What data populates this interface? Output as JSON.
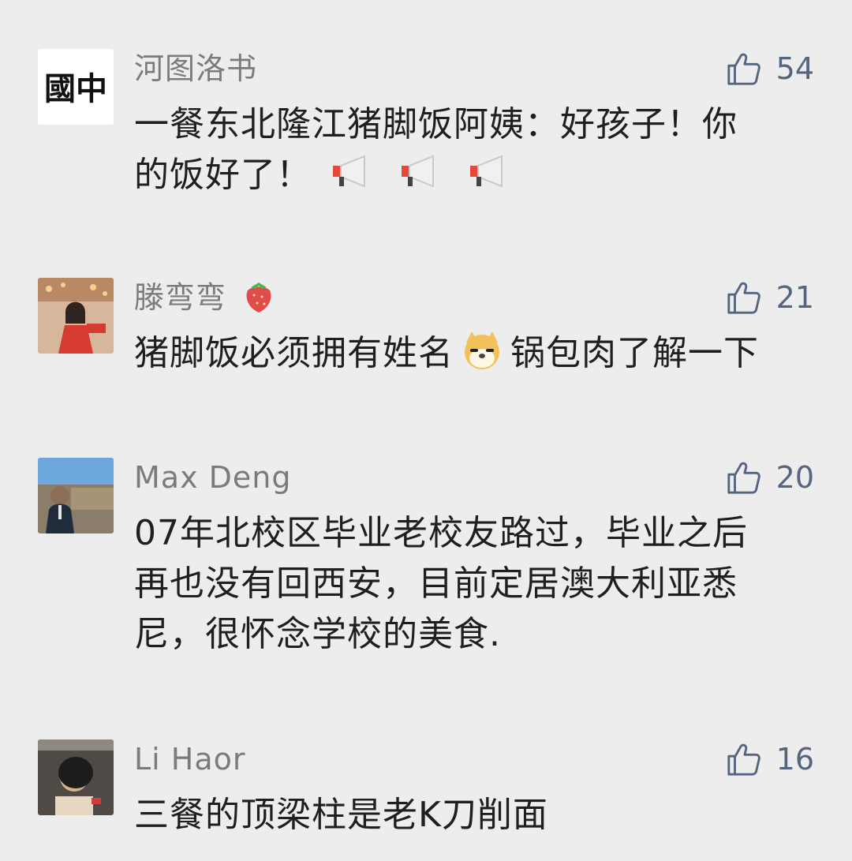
{
  "comments": [
    {
      "name": "河图洛书",
      "avatar_text": "國中",
      "likes": "54",
      "text_line1": "一餐东北隆江猪脚饭阿姨：好孩子！你",
      "text_line2": "的饭好了！",
      "emoji": "megaphone-icon"
    },
    {
      "name": "滕弯弯",
      "name_emoji": "strawberry-icon",
      "likes": "21",
      "text_before": "猪脚饭必须拥有姓名",
      "text_emoji": "doge-icon",
      "text_after": "锅包肉了解一下"
    },
    {
      "name": "Max Deng",
      "likes": "20",
      "text_line1": "07年北校区毕业老校友路过，毕业之后",
      "text_line2": "再也没有回西安，目前定居澳大利亚悉",
      "text_line3": "尼，很怀念学校的美食."
    },
    {
      "name": "Li Haor",
      "likes": "16",
      "text_line1": "三餐的顶梁柱是老K刀削面"
    }
  ],
  "colors": {
    "background": "#ededed",
    "name": "#7b7b7b",
    "like": "#55657f",
    "text": "#1f1f1f"
  }
}
